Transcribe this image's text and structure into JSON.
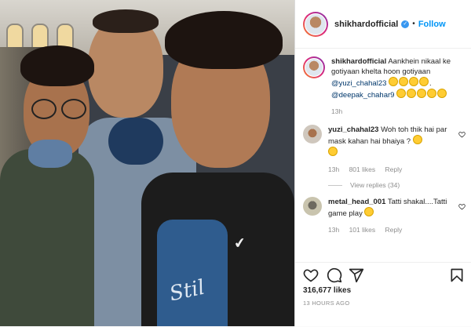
{
  "post": {
    "author": "shikhardofficial",
    "follow_label": "Follow",
    "separator": "•"
  },
  "comments": [
    {
      "username": "shikhardofficial",
      "text_parts": [
        "Aankhein nikaal ke gotiyaan khelta hoon gotiyaan"
      ],
      "mentions": [
        "@yuzi_chahal23",
        "@deepak_chahar9"
      ],
      "time": "13h",
      "emoji_count_1": 4,
      "emoji_count_2": 5
    },
    {
      "username": "yuzi_chahal23",
      "text": "Woh toh thik hai par mask kahan hai bhaiya ?",
      "time": "13h",
      "likes": "801 likes",
      "reply_label": "Reply",
      "view_replies": "View replies (34)"
    },
    {
      "username": "metal_head_001",
      "text": "Tatti shakal....Tatti game play",
      "time": "13h",
      "likes": "101 likes",
      "reply_label": "Reply"
    }
  ],
  "footer": {
    "like_count": "316,677 likes",
    "time_ago": "13 HOURS AGO"
  },
  "icons": [
    "heart-icon",
    "comment-icon",
    "share-icon",
    "bookmark-icon",
    "verified-icon"
  ],
  "colors": {
    "accent": "#0095f6",
    "verified": "#3897f0",
    "mention": "#00376b"
  }
}
